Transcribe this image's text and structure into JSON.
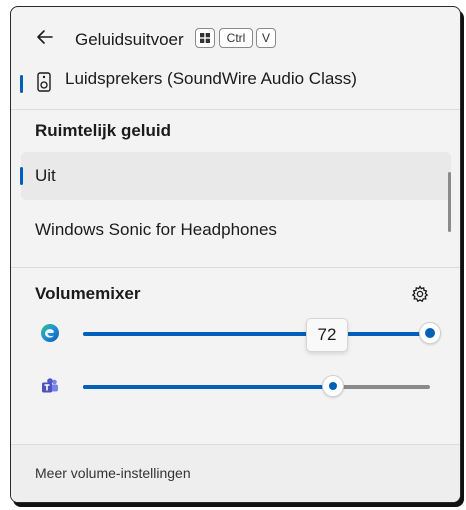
{
  "header": {
    "title": "Geluidsuitvoer",
    "shortcut": {
      "icon": "windows-key-icon",
      "key1": "Ctrl",
      "key2": "V"
    }
  },
  "output_device": {
    "label": "Luidsprekers (SoundWire Audio Class)",
    "icon": "speaker-icon"
  },
  "spatial_sound": {
    "heading": "Ruimtelijk geluid",
    "options": [
      {
        "label": "Uit",
        "selected": true
      },
      {
        "label": "Windows Sonic for Headphones",
        "selected": false
      }
    ]
  },
  "mixer": {
    "heading": "Volumemixer",
    "settings_icon": "gear-icon",
    "apps": [
      {
        "icon": "edge-icon",
        "volume": 100,
        "tooltip": "72"
      },
      {
        "icon": "teams-icon",
        "volume": 72
      }
    ]
  },
  "footer": {
    "link": "Meer volume-instellingen"
  },
  "colors": {
    "accent": "#005fb8",
    "panel": "#f3f3f3"
  }
}
